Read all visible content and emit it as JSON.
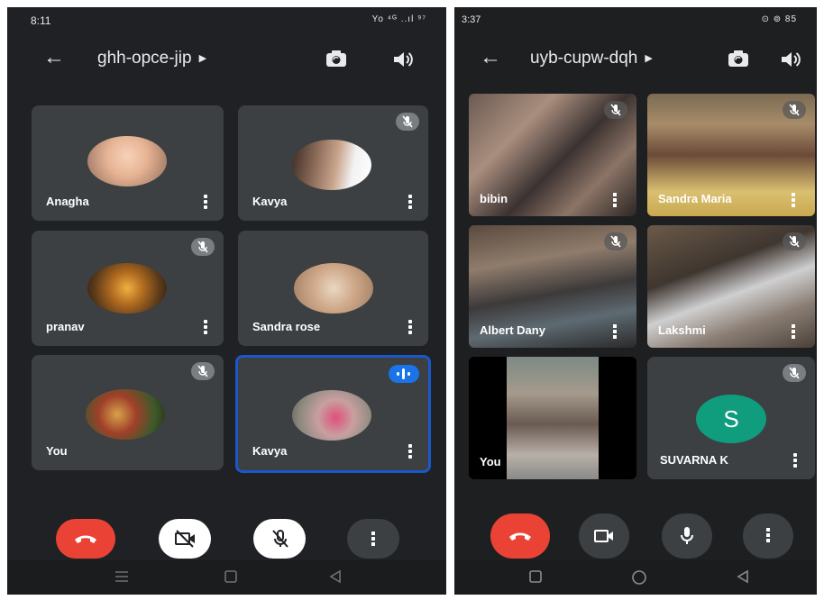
{
  "left_screen": {
    "status": {
      "time": "8:11",
      "indicators": "Yo ⁴ᴳ ..ıl ⁹⁷"
    },
    "meeting_code": "ghh-opce-jip",
    "participants": [
      {
        "name": "Anagha",
        "muted": false
      },
      {
        "name": "Kavya",
        "muted": true
      },
      {
        "name": "pranav",
        "muted": true
      },
      {
        "name": "Sandra rose",
        "muted": false
      },
      {
        "name": "You",
        "muted": true
      },
      {
        "name": "Kavya",
        "muted": false,
        "speaking": true
      }
    ],
    "controls": [
      "end-call",
      "camera-off",
      "mic-off",
      "more"
    ]
  },
  "right_screen": {
    "status": {
      "time": "3:37",
      "indicators": "⊙ ⊚ 85"
    },
    "meeting_code": "uyb-cupw-dqh",
    "participants": [
      {
        "name": "bibin",
        "muted": true
      },
      {
        "name": "Sandra Maria",
        "muted": true
      },
      {
        "name": "Albert Dany",
        "muted": true
      },
      {
        "name": "Lakshmi",
        "muted": true
      },
      {
        "name": "You",
        "muted": false
      },
      {
        "name": "SUVARNA K",
        "muted": true,
        "initial": "S"
      }
    ],
    "controls": [
      "end-call",
      "camera-on",
      "mic-on",
      "more"
    ]
  },
  "colors": {
    "background": "#202124",
    "tile": "#3c4043",
    "end_call": "#ea4335",
    "speaking_border": "#1a57c9",
    "avatar_teal": "#0f9d7e"
  }
}
